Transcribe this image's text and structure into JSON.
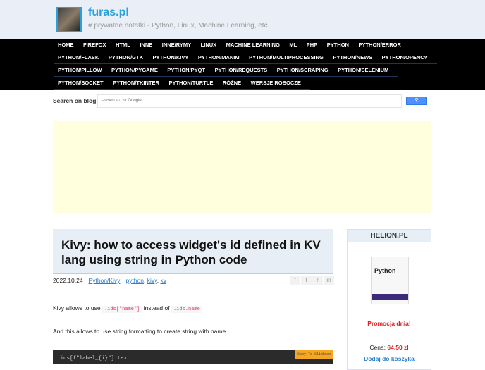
{
  "header": {
    "title": "furas.pl",
    "tagline": "# prywatne notatki - Python, Linux, Machine Learning, etc."
  },
  "nav": [
    [
      "HOME",
      "FIREFOX",
      "HTML",
      "INNE",
      "INNE/RYMY",
      "LINUX",
      "MACHINE LEARNING",
      "ML",
      "PHP",
      "PYTHON",
      "PYTHON/ERROR"
    ],
    [
      "PYTHON/FLASK",
      "PYTHON/GTK",
      "PYTHON/KIVY",
      "PYTHON/MANIM",
      "PYTHON/MULTIPROCESSING",
      "PYTHON/NEWS",
      "PYTHON/OPENCV"
    ],
    [
      "PYTHON/PILLOW",
      "PYTHON/PYGAME",
      "PYTHON/PYQT",
      "PYTHON/REQUESTS",
      "PYTHON/SCRAPING",
      "PYTHON/SELENIUM"
    ],
    [
      "PYTHON/SOCKET",
      "PYTHON/TKINTER",
      "PYTHON/TURTLE",
      "RÓŻNE",
      "WERSJE ROBOCZE"
    ]
  ],
  "search": {
    "label": "Search on blog:",
    "enhanced": "ENHANCED BY",
    "google": "Google"
  },
  "post": {
    "title": "Kivy: how to access widget's id defined in KV lang using string in Python code",
    "date": "2022.10.24",
    "category": "Python/Kivy",
    "tags": [
      "python",
      "kivy",
      "kv"
    ],
    "p1_a": "Kivy allows to use",
    "p1_code1": ".ids[\"name\"]",
    "p1_b": "instead of",
    "p1_code2": ".ids.name",
    "p2": "And this allows to use string formatting to create string with name",
    "code": ".ids[f\"label_{i}\"].text",
    "copy": "Copy To Clipboad"
  },
  "share": [
    "f",
    "t",
    "r",
    "in"
  ],
  "sidebar": {
    "title": "HELION.PL",
    "book_title": "Python",
    "promo": "Promocja dnia!",
    "price_label": "Cena:",
    "price": "64.50 zł",
    "cart": "Dodaj do koszyka"
  }
}
